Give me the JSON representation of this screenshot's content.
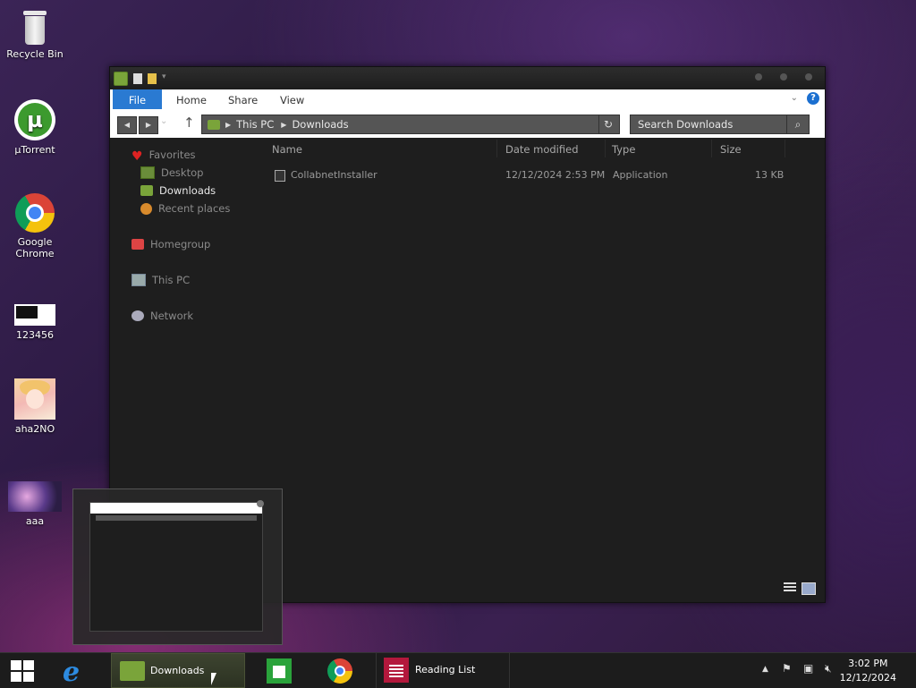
{
  "desktop": {
    "icons": [
      {
        "label": "Recycle Bin"
      },
      {
        "label": "µTorrent"
      },
      {
        "label": "Google Chrome"
      },
      {
        "label": "123456"
      },
      {
        "label": "aha2NO"
      },
      {
        "label": "aaa"
      }
    ]
  },
  "explorer": {
    "ribbon_tabs": [
      "File",
      "Home",
      "Share",
      "View"
    ],
    "help_label": "?",
    "breadcrumb": [
      "This PC",
      "Downloads"
    ],
    "search_placeholder": "Search Downloads",
    "nav": {
      "favorites": "Favorites",
      "desktop": "Desktop",
      "downloads": "Downloads",
      "recent_places": "Recent places",
      "homegroup": "Homegroup",
      "this_pc": "This PC",
      "network": "Network"
    },
    "columns": [
      "Name",
      "Date modified",
      "Type",
      "Size"
    ],
    "files": [
      {
        "name": "CollabnetInstaller",
        "date": "12/12/2024 2:53 PM",
        "type": "Application",
        "size": "13 KB"
      }
    ]
  },
  "taskbar": {
    "items": [
      {
        "label": "Downloads"
      },
      {
        "label": "Reading List"
      }
    ],
    "clock": {
      "time": "3:02 PM",
      "date": "12/12/2024"
    }
  },
  "colors": {
    "accent": "#2a7ad2",
    "folder": "#7aa43a",
    "reading_list": "#b3183c"
  }
}
